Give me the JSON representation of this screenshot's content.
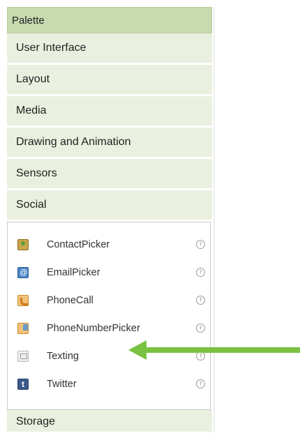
{
  "palette": {
    "title": "Palette",
    "categories": [
      {
        "label": "User Interface"
      },
      {
        "label": "Layout"
      },
      {
        "label": "Media"
      },
      {
        "label": "Drawing and Animation"
      },
      {
        "label": "Sensors"
      },
      {
        "label": "Social"
      }
    ],
    "social_components": [
      {
        "label": "ContactPicker",
        "icon": "contact-picker-icon"
      },
      {
        "label": "EmailPicker",
        "icon": "email-picker-icon"
      },
      {
        "label": "PhoneCall",
        "icon": "phone-call-icon"
      },
      {
        "label": "PhoneNumberPicker",
        "icon": "phone-number-picker-icon"
      },
      {
        "label": "Texting",
        "icon": "texting-icon"
      },
      {
        "label": "Twitter",
        "icon": "twitter-icon"
      }
    ],
    "help_glyph": "?",
    "footer_category": {
      "label": "Storage"
    }
  },
  "annotation": {
    "arrow_color": "#7ac142",
    "points_to": "Texting"
  },
  "colors": {
    "header_bg": "#c7dab0",
    "category_bg": "#eaf0df"
  }
}
